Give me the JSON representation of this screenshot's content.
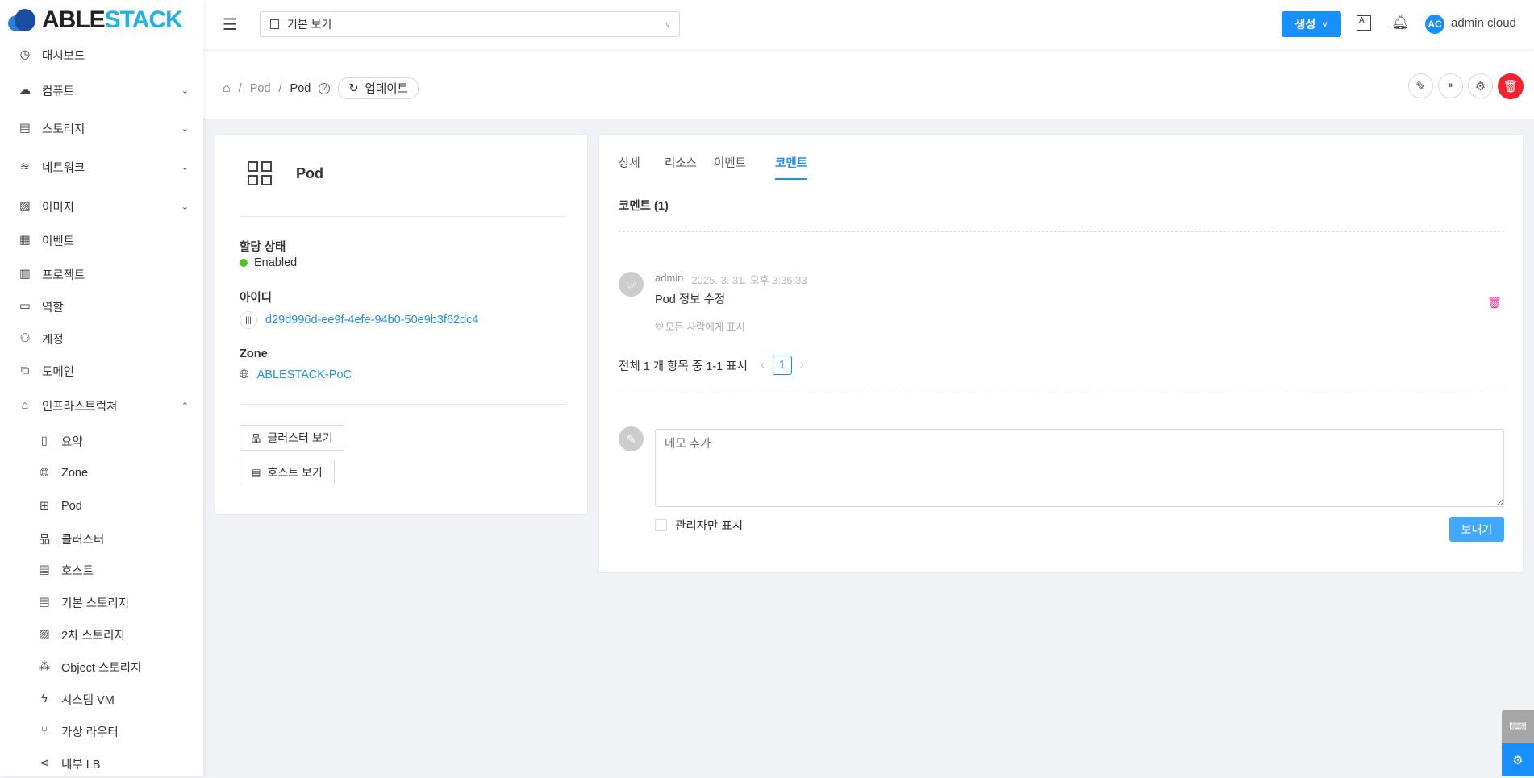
{
  "brand": {
    "part1": "ABLE",
    "part2": "STACK"
  },
  "sidebar": {
    "items": [
      {
        "label": "대시보드",
        "icon": "dashboard-icon"
      },
      {
        "label": "컴퓨트",
        "icon": "cloud-icon",
        "chevron": "down"
      },
      {
        "label": "스토리지",
        "icon": "storage-icon",
        "chevron": "down"
      },
      {
        "label": "네트워크",
        "icon": "wifi-icon",
        "chevron": "down"
      },
      {
        "label": "이미지",
        "icon": "image-icon",
        "chevron": "down"
      },
      {
        "label": "이벤트",
        "icon": "calendar-icon"
      },
      {
        "label": "프로젝트",
        "icon": "project-icon"
      },
      {
        "label": "역할",
        "icon": "idcard-icon"
      },
      {
        "label": "계정",
        "icon": "user-icon"
      },
      {
        "label": "도메인",
        "icon": "block-icon"
      },
      {
        "label": "인프라스트럭쳐",
        "icon": "bank-icon",
        "chevron": "up"
      }
    ],
    "sub_items": [
      {
        "label": "요약",
        "icon": "read-icon"
      },
      {
        "label": "Zone",
        "icon": "globe-icon"
      },
      {
        "label": "Pod",
        "icon": "appstore-icon"
      },
      {
        "label": "클러스터",
        "icon": "cluster-icon"
      },
      {
        "label": "호스트",
        "icon": "host-icon"
      },
      {
        "label": "기본 스토리지",
        "icon": "database-icon"
      },
      {
        "label": "2차 스토리지",
        "icon": "picture-icon"
      },
      {
        "label": "Object 스토리지",
        "icon": "gold-icon"
      },
      {
        "label": "시스템 VM",
        "icon": "thunderbolt-icon"
      },
      {
        "label": "가상 라우터",
        "icon": "fork-icon"
      },
      {
        "label": "내부 LB",
        "icon": "share-icon"
      }
    ]
  },
  "header": {
    "view_select": "기본 보기",
    "create_label": "생성",
    "user_initials": "AC",
    "user_name": "admin cloud"
  },
  "breadcrumb": {
    "items": [
      "Pod",
      "Pod"
    ],
    "refresh_label": "업데이트"
  },
  "details": {
    "title": "Pod",
    "state_label": "할당 상태",
    "state_value": "Enabled",
    "state_color": "#52c41a",
    "id_label": "아이디",
    "id_value": "d29d996d-ee9f-4efe-94b0-50e9b3f62dc4",
    "zone_label": "Zone",
    "zone_value": "ABLESTACK-PoC",
    "view_cluster": "클러스터 보기",
    "view_host": "호스트 보기"
  },
  "tabs": [
    "상세",
    "리소스",
    "이벤트",
    "코멘트"
  ],
  "comments": {
    "heading": "코멘트 (1)",
    "items": [
      {
        "author": "admin",
        "time": "2025. 3. 31. 오후 3:36:33",
        "text": "Pod 정보 수정",
        "visibility": "모든 사람에게 표시"
      }
    ],
    "pagination_text": "전체 1 개 항목 중 1-1 표시",
    "page": "1",
    "placeholder": "메모 추가",
    "admin_only_label": "관리자만 표시",
    "send_label": "보내기"
  },
  "colors": {
    "primary": "#1890ff",
    "danger": "#f5222d"
  }
}
